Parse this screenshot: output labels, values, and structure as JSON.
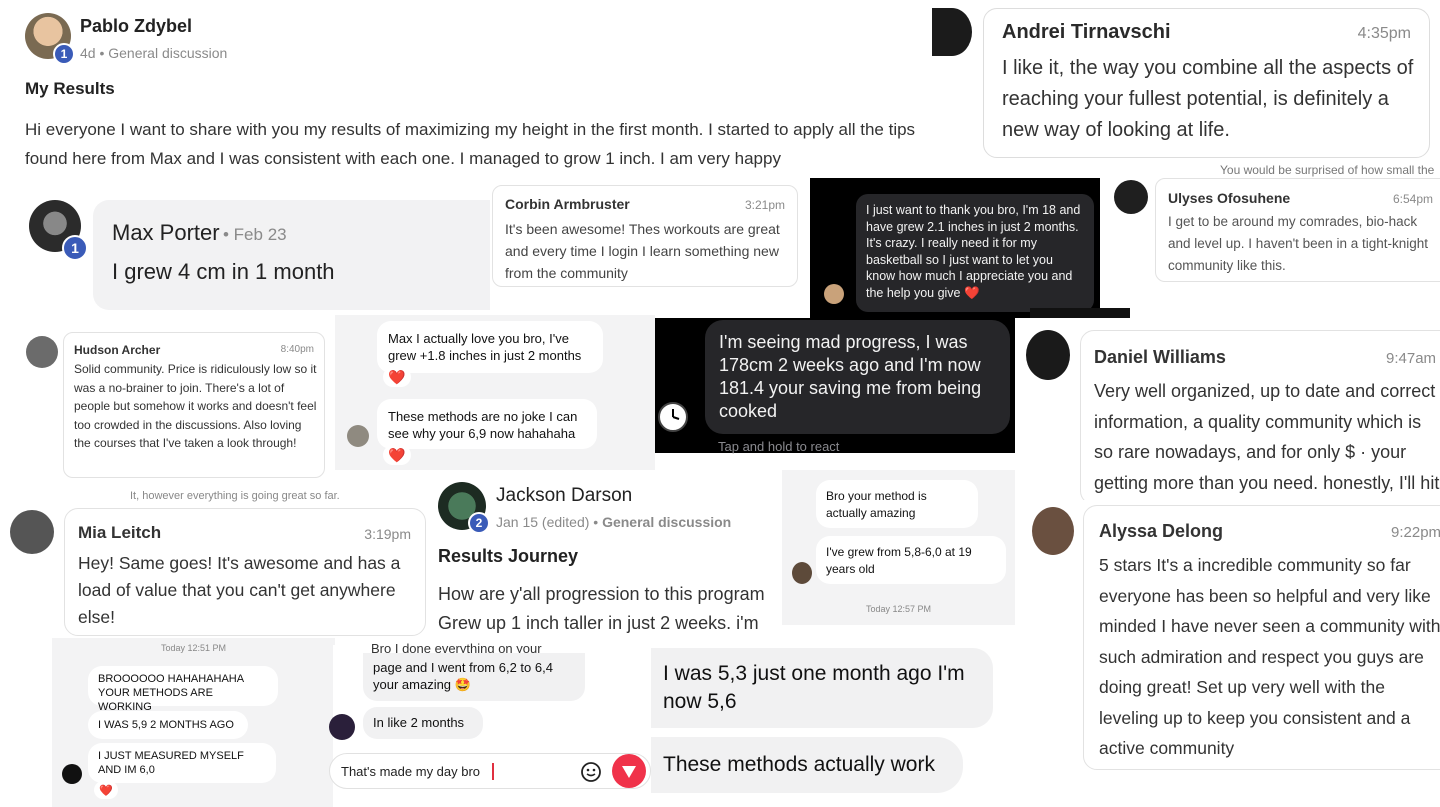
{
  "post1": {
    "author": "Pablo Zdybel",
    "level": "1",
    "meta": "4d • General discussion",
    "title": "My Results",
    "body": "Hi everyone I want to share with you my results of maximizing my height in the first month. I started to apply all the tips found here from Max and I was consistent with each one. I managed to grow 1 inch. I am very happy"
  },
  "andrei": {
    "name": "Andrei Tirnavschi",
    "time": "4:35pm",
    "text": "I like it, the way you combine all the aspects of reaching your fullest potential, is definitely a new way of looking at life."
  },
  "max": {
    "name": "Max Porter",
    "date": "• Feb 23",
    "level": "1",
    "text": "I grew 4 cm in 1 month"
  },
  "corbin": {
    "name": "Corbin Armbruster",
    "time": "3:21pm",
    "text": "It's been awesome! Thes workouts are great and every time I login I learn something new from the community"
  },
  "dm_thanks": {
    "text": "I just want to thank you bro, I'm 18 and have grew 2.1 inches in just 2 months. It's crazy. I really need it for my basketball so I just want to let you know how much I appreciate you and the help you give ❤️"
  },
  "ulyses": {
    "partial_top": "You would be surprised of how small the",
    "name": "Ulyses Ofosuhene",
    "time": "6:54pm",
    "text": "I get to be around my comrades, bio-hack and level up. I haven't been in a tight-knight community like this."
  },
  "hudson": {
    "name": "Hudson Archer",
    "time": "8:40pm",
    "text": "Solid community. Price is ridiculously low so it was a no-brainer to join. There's a lot of people but somehow it works and doesn't feel too crowded in the discussions. Also loving the courses that I've taken a look through!"
  },
  "dm_love": {
    "msg1": "Max I actually love you bro, I've grew +1.8 inches in just 2 months",
    "msg2": "These methods are no joke I can see why your 6,9 now hahahaha",
    "reaction": "❤️"
  },
  "dm_progress": {
    "text": "I'm seeing mad progress, I was 178cm 2 weeks ago and I'm now 181.4 your saving me from being cooked",
    "hint": "Tap and hold to react"
  },
  "daniel": {
    "name": "Daniel Williams",
    "time": "9:47am",
    "text": "Very well organized, up to date and correct information, a quality community which is so rare nowadays, and for only $ · your getting more than you need. honestly, I'll hit"
  },
  "mia": {
    "partial_top": "It, however everything is going great so far.",
    "name": "Mia Leitch",
    "time": "3:19pm",
    "text": "Hey! Same goes! It's awesome and has a load of value that you can't get anywhere else!"
  },
  "jackson": {
    "author": "Jackson Darson",
    "level": "2",
    "meta_date": "Jan 15 (edited) • ",
    "meta_cat": "General discussion",
    "title": "Results Journey",
    "body1": "How are y'all progression to this program",
    "body2": "Grew up 1 inch taller in just 2 weeks. i'm"
  },
  "dm_method": {
    "msg1": "Bro your method is actually amazing",
    "msg2": "I've grew from 5,8-6,0 at 19 years old",
    "stamp": "Today 12:57 PM"
  },
  "alyssa": {
    "name": "Alyssa Delong",
    "time": "9:22pm",
    "text": "5 stars It's a incredible community so far everyone has been so helpful and very like minded I have never seen a community with such admiration and respect you guys are doing great! Set up very well with the leveling up to keep you consistent and a active community"
  },
  "dm_caps": {
    "stamp": "Today 12:51 PM",
    "msg1": "BROOOOOO HAHAHAHAHA YOUR METHODS ARE WORKING",
    "msg2": "I WAS 5,9 2 MONTHS AGO",
    "msg3": "I JUST MEASURED MYSELF AND IM 6,0",
    "reaction": "❤️"
  },
  "dm_page": {
    "partial_top": "Bro I done everything on your",
    "msg1": "page and I went from 6,2 to 6,4 your amazing 🤩",
    "msg2": "In like 2 months",
    "input_value": "That's made my day bro"
  },
  "dm_big": {
    "msg1": "I was 5,3 just one month ago I'm now 5,6",
    "msg2": "These methods actually work"
  },
  "colors": {
    "badge": "#3a5bb8",
    "send": "#f0324a",
    "heart": "#e02424",
    "dark_bg": "#000000",
    "dark_bubble": "#262629"
  }
}
